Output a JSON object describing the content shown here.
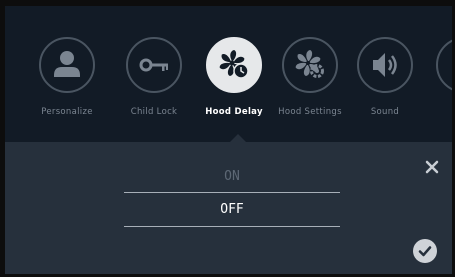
{
  "menu": {
    "items": [
      {
        "label": "Personalize",
        "icon": "person-icon"
      },
      {
        "label": "Child Lock",
        "icon": "key-icon"
      },
      {
        "label": "Hood Delay",
        "icon": "fan-clock-icon",
        "selected": true
      },
      {
        "label": "Hood Settings",
        "icon": "fan-gear-icon"
      },
      {
        "label": "Sound",
        "icon": "speaker-icon"
      },
      {
        "label": "",
        "icon": "partial-icon"
      }
    ]
  },
  "panel": {
    "options": [
      "ON",
      "OFF"
    ],
    "selected_option": "OFF",
    "close_icon": "close-icon",
    "confirm_icon": "checkmark-icon"
  },
  "colors": {
    "background": "#121b26",
    "panel": "#26303c",
    "selected_circle": "#e6e8ea",
    "inactive_icon": "#7b8591"
  }
}
